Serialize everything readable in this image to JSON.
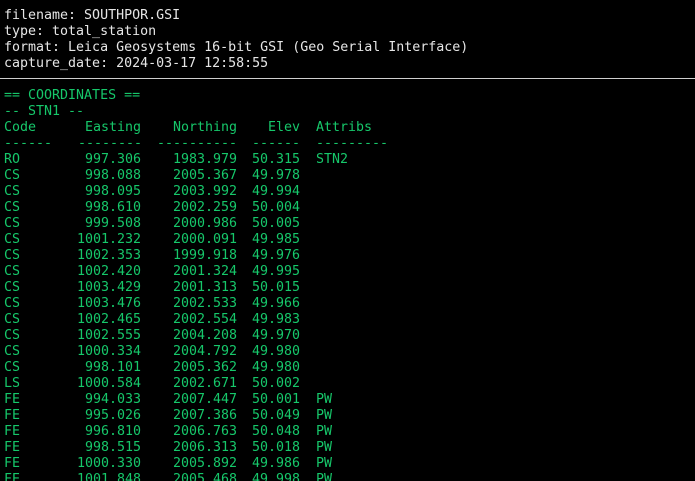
{
  "header": {
    "filename_line": "filename: SOUTHPOR.GSI",
    "type_line": "type: total_station",
    "format_line": "format: Leica Geosystems 16-bit GSI (Geo Serial Interface)",
    "capture_line": "capture_date: 2024-03-17 12:58:55"
  },
  "section": {
    "title": "== COORDINATES ==",
    "station": "-- STN1 --"
  },
  "columns": {
    "code": "Code",
    "easting": "Easting",
    "northing": "Northing",
    "elev": "Elev",
    "attribs": "Attribs"
  },
  "underlines": {
    "code": "------",
    "easting": "--------",
    "northing": "----------",
    "elev": "------",
    "attribs": "---------"
  },
  "rows": [
    {
      "code": "RO",
      "easting": "997.306",
      "northing": "1983.979",
      "elev": "50.315",
      "attrib": "STN2"
    },
    {
      "code": "CS",
      "easting": "998.088",
      "northing": "2005.367",
      "elev": "49.978",
      "attrib": ""
    },
    {
      "code": "CS",
      "easting": "998.095",
      "northing": "2003.992",
      "elev": "49.994",
      "attrib": ""
    },
    {
      "code": "CS",
      "easting": "998.610",
      "northing": "2002.259",
      "elev": "50.004",
      "attrib": ""
    },
    {
      "code": "CS",
      "easting": "999.508",
      "northing": "2000.986",
      "elev": "50.005",
      "attrib": ""
    },
    {
      "code": "CS",
      "easting": "1001.232",
      "northing": "2000.091",
      "elev": "49.985",
      "attrib": ""
    },
    {
      "code": "CS",
      "easting": "1002.353",
      "northing": "1999.918",
      "elev": "49.976",
      "attrib": ""
    },
    {
      "code": "CS",
      "easting": "1002.420",
      "northing": "2001.324",
      "elev": "49.995",
      "attrib": ""
    },
    {
      "code": "CS",
      "easting": "1003.429",
      "northing": "2001.313",
      "elev": "50.015",
      "attrib": ""
    },
    {
      "code": "CS",
      "easting": "1003.476",
      "northing": "2002.533",
      "elev": "49.966",
      "attrib": ""
    },
    {
      "code": "CS",
      "easting": "1002.465",
      "northing": "2002.554",
      "elev": "49.983",
      "attrib": ""
    },
    {
      "code": "CS",
      "easting": "1002.555",
      "northing": "2004.208",
      "elev": "49.970",
      "attrib": ""
    },
    {
      "code": "CS",
      "easting": "1000.334",
      "northing": "2004.792",
      "elev": "49.980",
      "attrib": ""
    },
    {
      "code": "CS",
      "easting": "998.101",
      "northing": "2005.362",
      "elev": "49.980",
      "attrib": ""
    },
    {
      "code": "LS",
      "easting": "1000.584",
      "northing": "2002.671",
      "elev": "50.002",
      "attrib": ""
    },
    {
      "code": "FE",
      "easting": "994.033",
      "northing": "2007.447",
      "elev": "50.001",
      "attrib": "PW"
    },
    {
      "code": "FE",
      "easting": "995.026",
      "northing": "2007.386",
      "elev": "50.049",
      "attrib": "PW"
    },
    {
      "code": "FE",
      "easting": "996.810",
      "northing": "2006.763",
      "elev": "50.048",
      "attrib": "PW"
    },
    {
      "code": "FE",
      "easting": "998.515",
      "northing": "2006.313",
      "elev": "50.018",
      "attrib": "PW"
    },
    {
      "code": "FE",
      "easting": "1000.330",
      "northing": "2005.892",
      "elev": "49.986",
      "attrib": "PW"
    },
    {
      "code": "FE",
      "easting": "1001.848",
      "northing": "2005.468",
      "elev": "49.998",
      "attrib": "PW"
    }
  ],
  "colors": {
    "background": "#000000",
    "meta_text": "#e6e6e6",
    "data_text": "#16c76a",
    "rule": "#cfcfcf"
  }
}
